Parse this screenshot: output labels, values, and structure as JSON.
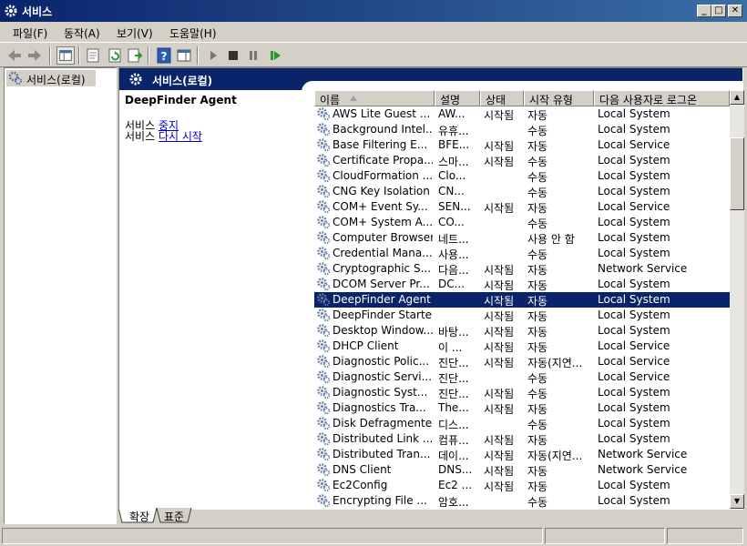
{
  "window": {
    "title": "서비스"
  },
  "menu": [
    {
      "label": "파일(F)"
    },
    {
      "label": "동작(A)"
    },
    {
      "label": "보기(V)"
    },
    {
      "label": "도움말(H)"
    }
  ],
  "tree": {
    "root_label": "서비스(로컬)"
  },
  "main": {
    "header_title": "서비스(로컬)",
    "selected_service": "DeepFinder Agent",
    "action_stop_prefix": "서비스 ",
    "action_stop_link": "중지",
    "action_restart_prefix": "서비스 ",
    "action_restart_link": "다시 시작"
  },
  "columns": [
    {
      "label": "이름"
    },
    {
      "label": "설명"
    },
    {
      "label": "상태"
    },
    {
      "label": "시작 유형"
    },
    {
      "label": "다음 사용자로 로그온"
    }
  ],
  "rows": [
    [
      "AWS Lite Guest ...",
      "AW...",
      "시작됨",
      "자동",
      "Local System"
    ],
    [
      "Background Intel...",
      "유휴...",
      "",
      "수동",
      "Local System"
    ],
    [
      "Base Filtering E...",
      "BFE...",
      "시작됨",
      "자동",
      "Local Service"
    ],
    [
      "Certificate Propa...",
      "스마...",
      "시작됨",
      "수동",
      "Local System"
    ],
    [
      "CloudFormation ...",
      "Clo...",
      "",
      "수동",
      "Local System"
    ],
    [
      "CNG Key Isolation",
      "CN...",
      "",
      "수동",
      "Local System"
    ],
    [
      "COM+ Event Sy...",
      "SEN...",
      "시작됨",
      "자동",
      "Local Service"
    ],
    [
      "COM+ System A...",
      "CO...",
      "",
      "수동",
      "Local System"
    ],
    [
      "Computer Browser",
      "네트...",
      "",
      "사용 안 함",
      "Local System"
    ],
    [
      "Credential Mana...",
      "사용...",
      "",
      "수동",
      "Local System"
    ],
    [
      "Cryptographic S...",
      "다음...",
      "시작됨",
      "자동",
      "Network Service"
    ],
    [
      "DCOM Server Pr...",
      "DC...",
      "시작됨",
      "자동",
      "Local System"
    ],
    [
      "DeepFinder Agent",
      "",
      "시작됨",
      "자동",
      "Local System"
    ],
    [
      "DeepFinder Starter",
      "",
      "시작됨",
      "자동",
      "Local System"
    ],
    [
      "Desktop Window...",
      "바탕...",
      "시작됨",
      "자동",
      "Local System"
    ],
    [
      "DHCP Client",
      "이 ...",
      "시작됨",
      "자동",
      "Local Service"
    ],
    [
      "Diagnostic Polic...",
      "진단...",
      "시작됨",
      "자동(지연...",
      "Local Service"
    ],
    [
      "Diagnostic Servi...",
      "진단...",
      "",
      "수동",
      "Local Service"
    ],
    [
      "Diagnostic Syst...",
      "진단...",
      "시작됨",
      "수동",
      "Local System"
    ],
    [
      "Diagnostics Tra...",
      "The...",
      "시작됨",
      "자동",
      "Local System"
    ],
    [
      "Disk Defragmenter",
      "디스...",
      "",
      "수동",
      "Local System"
    ],
    [
      "Distributed Link ...",
      "컴퓨...",
      "시작됨",
      "자동",
      "Local System"
    ],
    [
      "Distributed Tran...",
      "데이...",
      "시작됨",
      "자동(지연...",
      "Network Service"
    ],
    [
      "DNS Client",
      "DNS...",
      "시작됨",
      "자동",
      "Network Service"
    ],
    [
      "Ec2Config",
      "Ec2 ...",
      "시작됨",
      "자동",
      "Local System"
    ],
    [
      "Encrypting File ...",
      "암호...",
      "",
      "수동",
      "Local System"
    ]
  ],
  "selected_row_index": 12,
  "bottom_tabs": [
    {
      "label": "확장"
    },
    {
      "label": "표준"
    }
  ],
  "colors": {
    "selection": "#0a246a",
    "titlebar": "#0a246a",
    "link": "#0000cc"
  }
}
